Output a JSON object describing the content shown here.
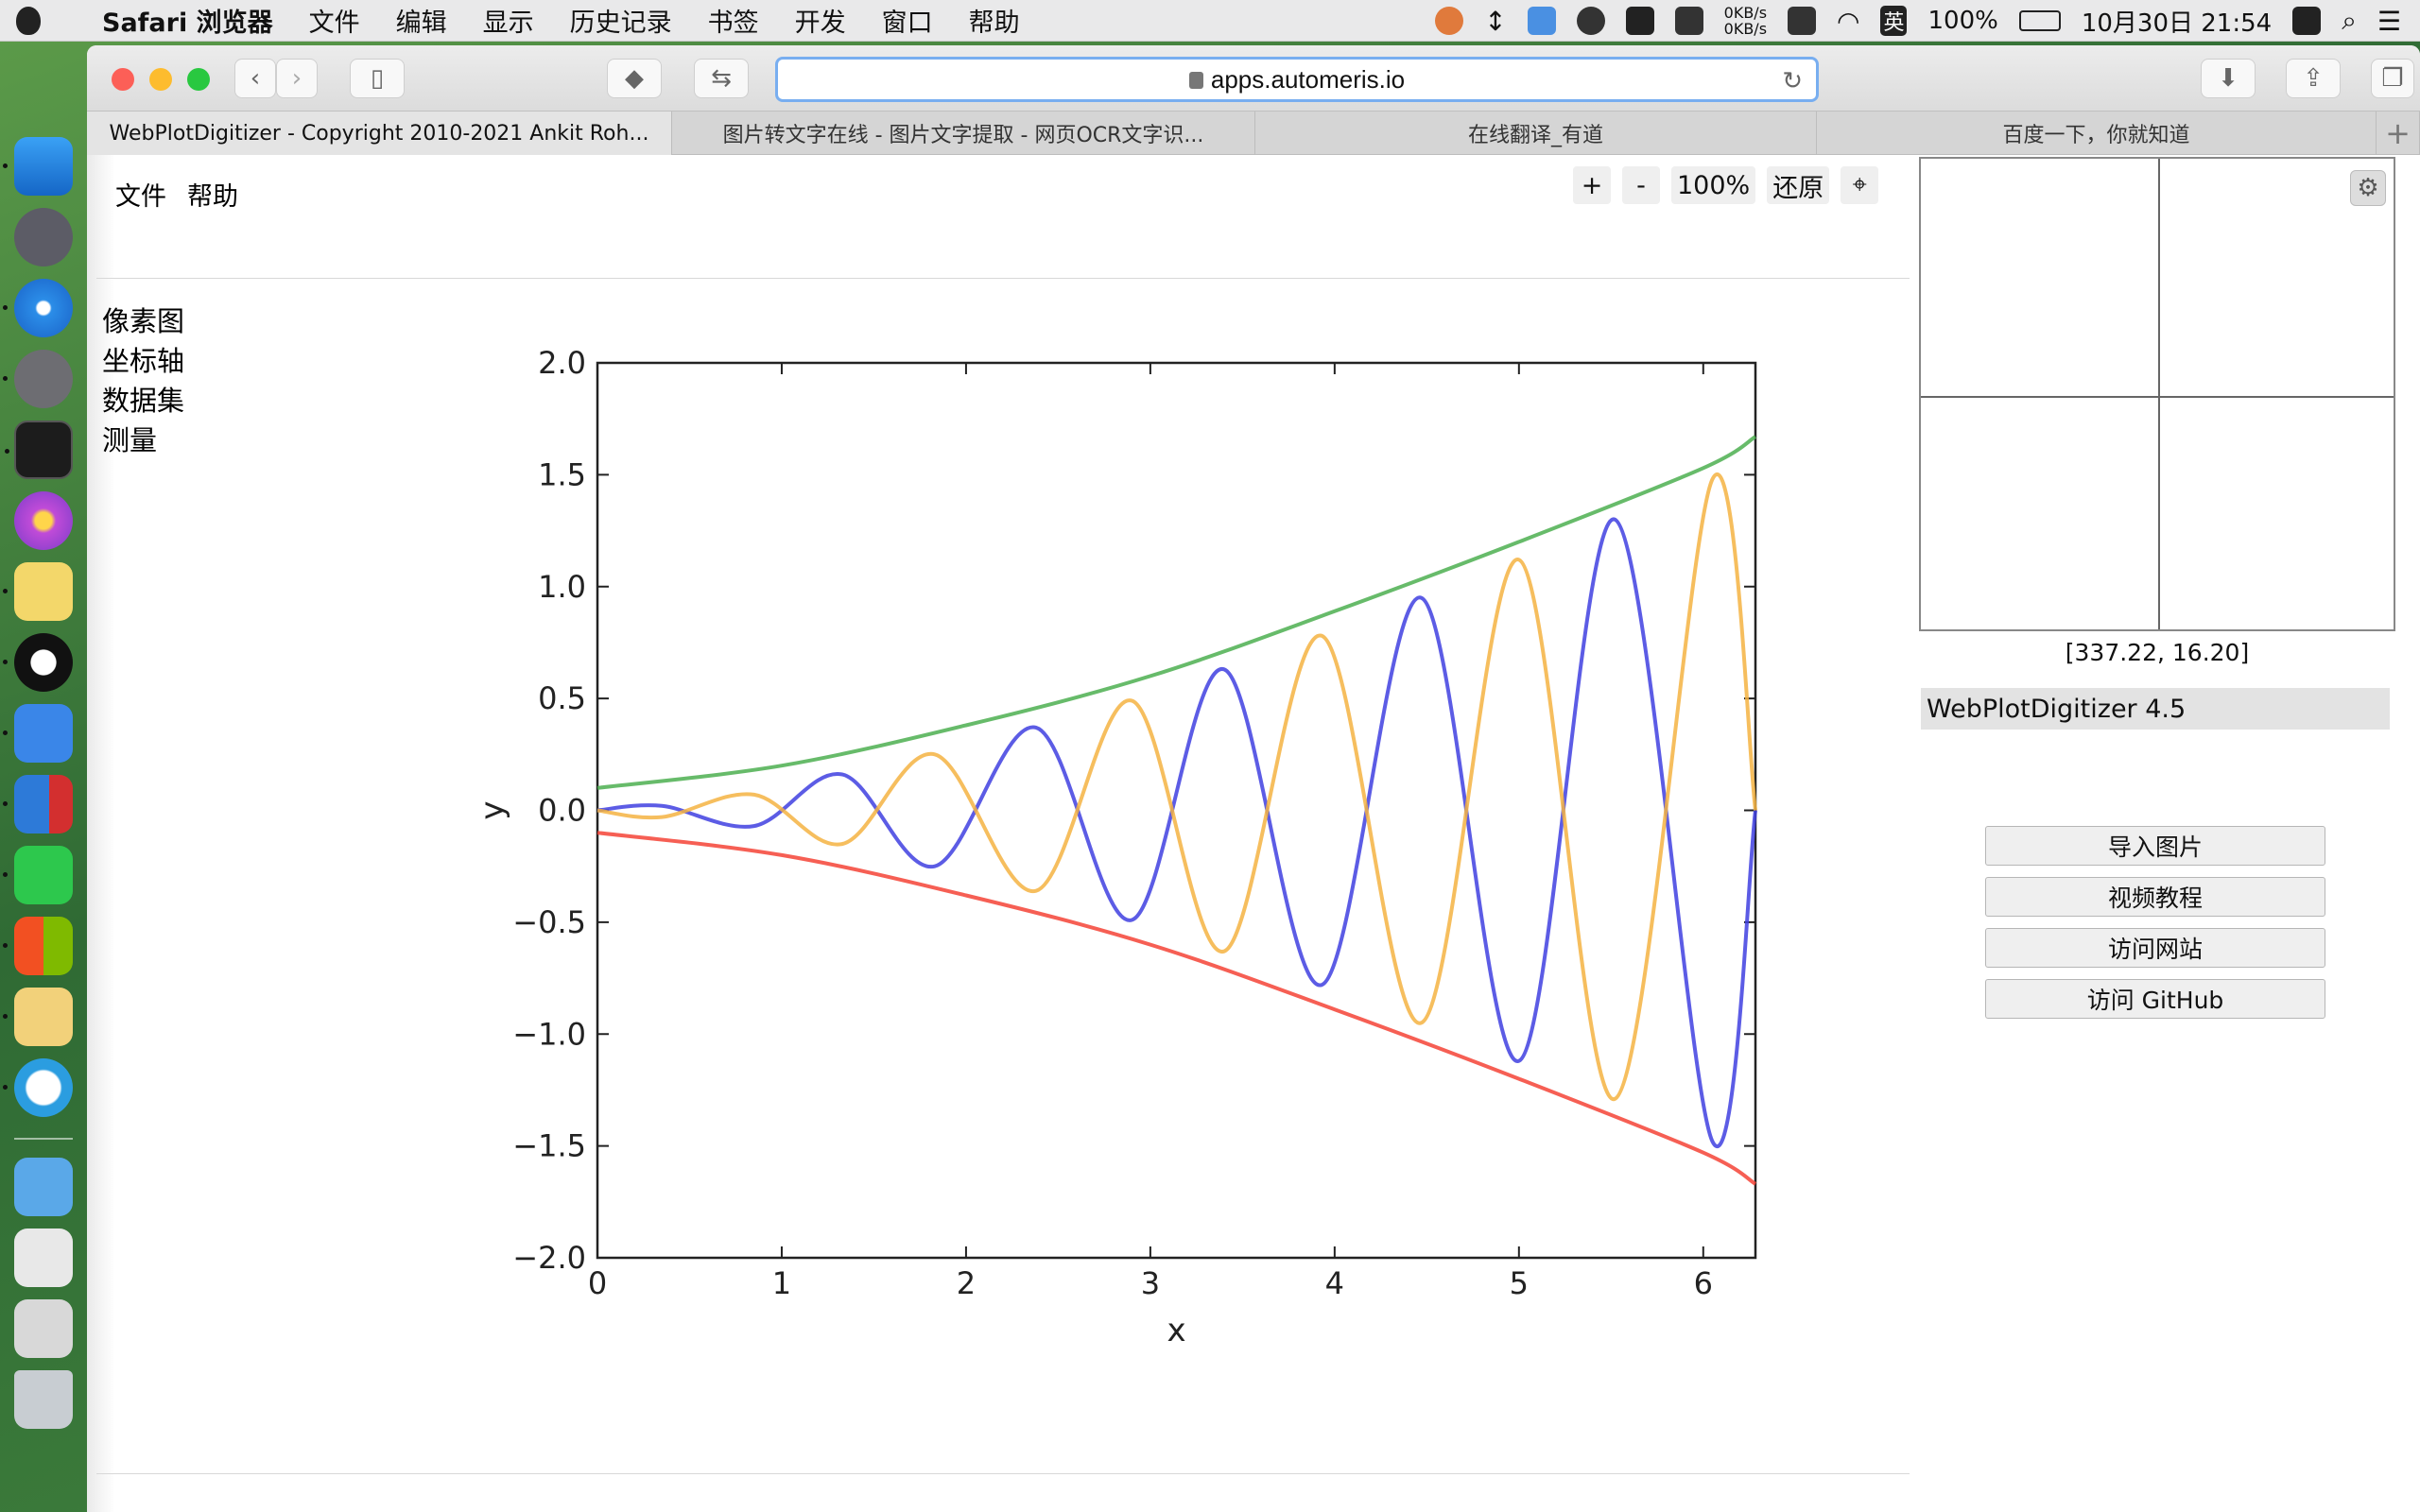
{
  "menubar": {
    "app_name": "Safari 浏览器",
    "items": [
      "文件",
      "编辑",
      "显示",
      "历史记录",
      "书签",
      "开发",
      "窗口",
      "帮助"
    ],
    "net_up": "0KB/s",
    "net_down": "0KB/s",
    "input_method": "英",
    "battery": "100%",
    "datetime": "10月30日 21:54"
  },
  "browser": {
    "url": "apps.automeris.io",
    "tabs": [
      "WebPlotDigitizer - Copyright 2010-2021 Ankit Roh...",
      "图片转文字在线 - 图片文字提取 - 网页OCR文字识...",
      "在线翻译_有道",
      "百度一下，你就知道"
    ],
    "new_tab": "+"
  },
  "app": {
    "top_menu": [
      "文件",
      "帮助"
    ],
    "side_menu": [
      "像素图",
      "坐标轴",
      "数据集",
      "测量"
    ],
    "zoom": {
      "plus": "+",
      "minus": "-",
      "level": "100%",
      "reset": "还原"
    },
    "cursor_coords": "[337.22, 16.20]",
    "version": "WebPlotDigitizer 4.5",
    "buttons": [
      "导入图片",
      "视频教程",
      "访问网站",
      "访问 GitHub"
    ]
  },
  "chart_data": {
    "type": "line",
    "title": "",
    "xlabel": "x",
    "ylabel": "y",
    "xlim": [
      0,
      6.2832
    ],
    "ylim": [
      -2.0,
      2.0
    ],
    "x_ticks": [
      "0",
      "1",
      "2",
      "3",
      "4",
      "5",
      "6"
    ],
    "y_ticks": [
      "2.0",
      "1.5",
      "1.0",
      "0.5",
      "0.0",
      "−0.5",
      "−1.0",
      "−1.5",
      "−2.0"
    ],
    "series": [
      {
        "color": "#4caf50",
        "x": [
          0,
          1,
          2,
          3,
          4,
          5,
          6,
          6.283
        ],
        "y": [
          0.1,
          0.2,
          0.38,
          0.6,
          0.89,
          1.2,
          1.53,
          1.67
        ]
      },
      {
        "color": "#f44336",
        "x": [
          0,
          1,
          2,
          3,
          4,
          5,
          6,
          6.283
        ],
        "y": [
          -0.1,
          -0.2,
          -0.38,
          -0.6,
          -0.89,
          -1.2,
          -1.53,
          -1.67
        ]
      },
      {
        "color": "#3f3fe0",
        "x": [
          0,
          0.35,
          0.85,
          1.33,
          1.83,
          2.38,
          2.9,
          3.4,
          3.93,
          4.47,
          5.0,
          5.52,
          6.05,
          6.283
        ],
        "y": [
          0.0,
          0.02,
          -0.07,
          0.16,
          -0.25,
          0.37,
          -0.49,
          0.63,
          -0.78,
          0.95,
          -1.12,
          1.3,
          -1.48,
          0.0
        ]
      },
      {
        "color": "#f5b342",
        "x": [
          0,
          0.35,
          0.85,
          1.33,
          1.83,
          2.38,
          2.9,
          3.4,
          3.93,
          4.47,
          5.0,
          5.52,
          6.05,
          6.283
        ],
        "y": [
          0.0,
          -0.03,
          0.07,
          -0.15,
          0.25,
          -0.36,
          0.49,
          -0.63,
          0.78,
          -0.95,
          1.12,
          -1.29,
          1.48,
          0.0
        ]
      }
    ]
  }
}
